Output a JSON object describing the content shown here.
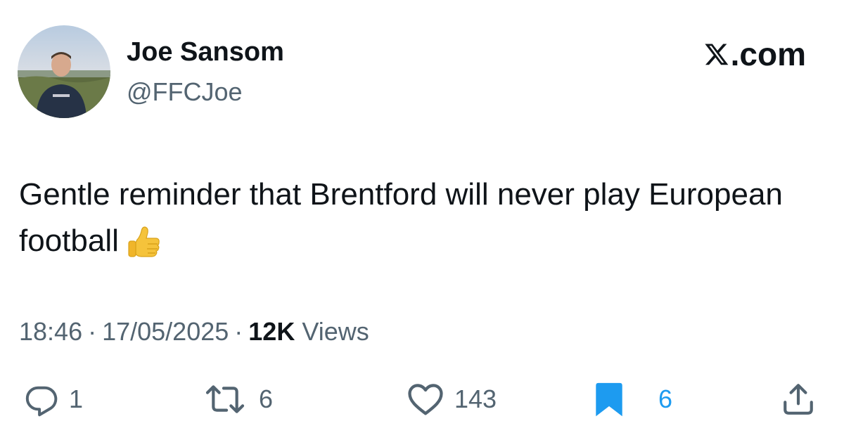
{
  "author": {
    "name": "Joe Sansom",
    "handle": "@FFCJoe",
    "avatar_icon": "profile-photo"
  },
  "site": {
    "label": ".com",
    "logo_icon": "x-logo-icon"
  },
  "tweet": {
    "text": "Gentle reminder that Brentford will never play European football",
    "emoji_icon": "thumbs-up-emoji"
  },
  "meta": {
    "time": "18:46",
    "separator": "·",
    "date": "17/05/2025",
    "views_count": "12K",
    "views_label": "Views"
  },
  "actions": {
    "replies": "1",
    "reposts": "6",
    "likes": "143",
    "bookmarks": "6"
  },
  "colors": {
    "text_primary": "#0f1419",
    "text_secondary": "#536471",
    "bookmark_active": "#1d9bf0"
  }
}
